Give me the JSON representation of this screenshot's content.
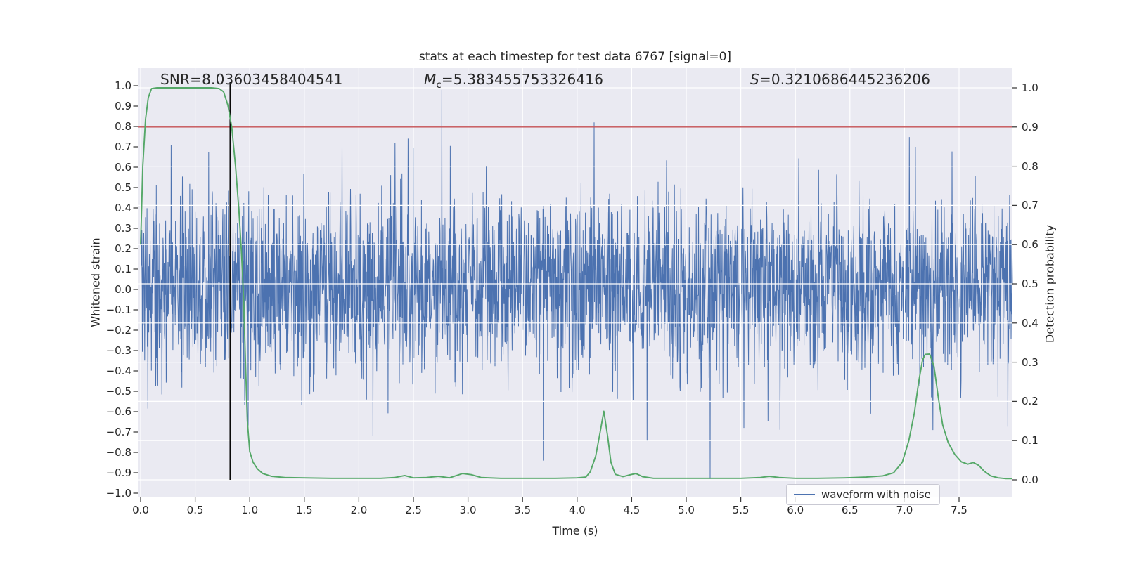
{
  "title": "stats at each timestep for test data 6767 [signal=0]",
  "annotations": {
    "snr": "SNR=8.03603458404541",
    "mc_symbol": "M",
    "mc_subscript": "c",
    "mc_value": "=5.383455753326416",
    "s_symbol": "S",
    "s_value": "=0.3210686445236206"
  },
  "legend": {
    "label": "waveform with noise"
  },
  "axes": {
    "x": {
      "label": "Time (s)",
      "tick_labels": [
        "0.0",
        "0.5",
        "1.0",
        "1.5",
        "2.0",
        "2.5",
        "3.0",
        "3.5",
        "4.0",
        "4.5",
        "5.0",
        "5.5",
        "6.0",
        "6.5",
        "7.0",
        "7.5"
      ],
      "tick_values": [
        0,
        0.5,
        1,
        1.5,
        2,
        2.5,
        3,
        3.5,
        4,
        4.5,
        5,
        5.5,
        6,
        6.5,
        7,
        7.5
      ]
    },
    "y_left": {
      "label": "Whitened strain",
      "tick_labels": [
        "1.0",
        "0.9",
        "0.8",
        "0.7",
        "0.6",
        "0.5",
        "0.4",
        "0.3",
        "0.2",
        "0.1",
        "0.0",
        "−0.1",
        "−0.2",
        "−0.3",
        "−0.4",
        "−0.5",
        "−0.6",
        "−0.7",
        "−0.8",
        "−0.9",
        "−1.0"
      ],
      "tick_values": [
        1.0,
        0.9,
        0.8,
        0.7,
        0.6,
        0.5,
        0.4,
        0.3,
        0.2,
        0.1,
        0.0,
        -0.1,
        -0.2,
        -0.3,
        -0.4,
        -0.5,
        -0.6,
        -0.7,
        -0.8,
        -0.9,
        -1.0
      ]
    },
    "y_right": {
      "label": "Detection probability",
      "tick_labels": [
        "1.0",
        "0.9",
        "0.8",
        "0.7",
        "0.6",
        "0.5",
        "0.4",
        "0.3",
        "0.2",
        "0.1",
        "0.0"
      ],
      "tick_values": [
        1.0,
        0.9,
        0.8,
        0.7,
        0.6,
        0.5,
        0.4,
        0.3,
        0.2,
        0.1,
        0.0
      ]
    }
  },
  "colors": {
    "waveform": "#4C72B0",
    "probability": "#55A868",
    "threshold": "#C44E52",
    "marker": "#0a0a0a",
    "plot_bg": "#EAEAF2",
    "grid": "#FFFFFF",
    "tick": "#3a3a3a",
    "text": "#262626"
  },
  "chart_data": {
    "type": "line",
    "title": "stats at each timestep for test data 6767 [signal=0]",
    "xlabel": "Time (s)",
    "ylabel_left": "Whitened strain",
    "ylabel_right": "Detection probability",
    "xlim": [
      0,
      8
    ],
    "ylim_left": [
      -1.02,
      1.09
    ],
    "ylim_right": [
      -0.05,
      1.05
    ],
    "grid": "white gridlines at right-axis ticks (0.0-1.0 step 0.1) and x ticks (step 0.5)",
    "legend_position": "lower right",
    "stats": {
      "SNR": 8.03603458404541,
      "Mc": 5.383455753326416,
      "S": 0.3210686445236206
    },
    "series": [
      {
        "name": "waveform with noise",
        "axis": "left",
        "style": "dense gaussian noise line",
        "noise": {
          "n": 3000,
          "t_start": 0,
          "t_end": 7.99,
          "mean": 0.015,
          "sigma": 0.215,
          "seed": 20
        },
        "outliers": [
          [
            0.28,
            0.71
          ],
          [
            2.33,
            0.72
          ],
          [
            2.45,
            0.74
          ],
          [
            2.76,
            0.98
          ],
          [
            3.69,
            -0.84
          ],
          [
            4.155,
            0.82
          ],
          [
            4.64,
            -0.745
          ],
          [
            5.22,
            -0.93
          ],
          [
            7.1,
            0.7
          ],
          [
            7.26,
            -0.69
          ]
        ]
      },
      {
        "name": "detection probability",
        "axis": "right",
        "points": [
          [
            0,
            0.6
          ],
          [
            0.02,
            0.8
          ],
          [
            0.045,
            0.92
          ],
          [
            0.07,
            0.975
          ],
          [
            0.1,
            0.998
          ],
          [
            0.15,
            1.0
          ],
          [
            0.3,
            1.0
          ],
          [
            0.5,
            1.0
          ],
          [
            0.65,
            1.0
          ],
          [
            0.72,
            0.998
          ],
          [
            0.76,
            0.99
          ],
          [
            0.8,
            0.955
          ],
          [
            0.835,
            0.9
          ],
          [
            0.87,
            0.8
          ],
          [
            0.9,
            0.69
          ],
          [
            0.925,
            0.575
          ],
          [
            0.945,
            0.45
          ],
          [
            0.962,
            0.29
          ],
          [
            0.978,
            0.15
          ],
          [
            1.0,
            0.072
          ],
          [
            1.03,
            0.045
          ],
          [
            1.07,
            0.028
          ],
          [
            1.12,
            0.016
          ],
          [
            1.2,
            0.009
          ],
          [
            1.32,
            0.006
          ],
          [
            1.5,
            0.005
          ],
          [
            1.75,
            0.004
          ],
          [
            2.0,
            0.004
          ],
          [
            2.2,
            0.004
          ],
          [
            2.33,
            0.006
          ],
          [
            2.42,
            0.011
          ],
          [
            2.5,
            0.005
          ],
          [
            2.62,
            0.006
          ],
          [
            2.73,
            0.009
          ],
          [
            2.83,
            0.005
          ],
          [
            2.95,
            0.016
          ],
          [
            3.03,
            0.013
          ],
          [
            3.12,
            0.006
          ],
          [
            3.3,
            0.004
          ],
          [
            3.55,
            0.004
          ],
          [
            3.8,
            0.004
          ],
          [
            4.0,
            0.005
          ],
          [
            4.08,
            0.007
          ],
          [
            4.12,
            0.02
          ],
          [
            4.17,
            0.06
          ],
          [
            4.21,
            0.12
          ],
          [
            4.245,
            0.175
          ],
          [
            4.28,
            0.11
          ],
          [
            4.31,
            0.045
          ],
          [
            4.35,
            0.014
          ],
          [
            4.42,
            0.008
          ],
          [
            4.49,
            0.013
          ],
          [
            4.54,
            0.016
          ],
          [
            4.6,
            0.008
          ],
          [
            4.7,
            0.004
          ],
          [
            4.9,
            0.004
          ],
          [
            5.2,
            0.004
          ],
          [
            5.5,
            0.004
          ],
          [
            5.68,
            0.006
          ],
          [
            5.76,
            0.009
          ],
          [
            5.85,
            0.006
          ],
          [
            6.0,
            0.004
          ],
          [
            6.2,
            0.004
          ],
          [
            6.45,
            0.005
          ],
          [
            6.65,
            0.007
          ],
          [
            6.8,
            0.01
          ],
          [
            6.9,
            0.018
          ],
          [
            6.98,
            0.045
          ],
          [
            7.04,
            0.1
          ],
          [
            7.09,
            0.17
          ],
          [
            7.13,
            0.25
          ],
          [
            7.165,
            0.305
          ],
          [
            7.19,
            0.32
          ],
          [
            7.23,
            0.321
          ],
          [
            7.27,
            0.29
          ],
          [
            7.31,
            0.21
          ],
          [
            7.35,
            0.14
          ],
          [
            7.4,
            0.095
          ],
          [
            7.46,
            0.065
          ],
          [
            7.52,
            0.046
          ],
          [
            7.58,
            0.04
          ],
          [
            7.63,
            0.044
          ],
          [
            7.68,
            0.037
          ],
          [
            7.73,
            0.022
          ],
          [
            7.79,
            0.01
          ],
          [
            7.86,
            0.005
          ],
          [
            7.93,
            0.003
          ],
          [
            7.99,
            0.003
          ]
        ]
      },
      {
        "name": "detection threshold",
        "axis": "right",
        "type": "hline",
        "y": 0.9
      },
      {
        "name": "event time marker",
        "axis": "left",
        "type": "vline",
        "x": 0.82
      }
    ]
  }
}
